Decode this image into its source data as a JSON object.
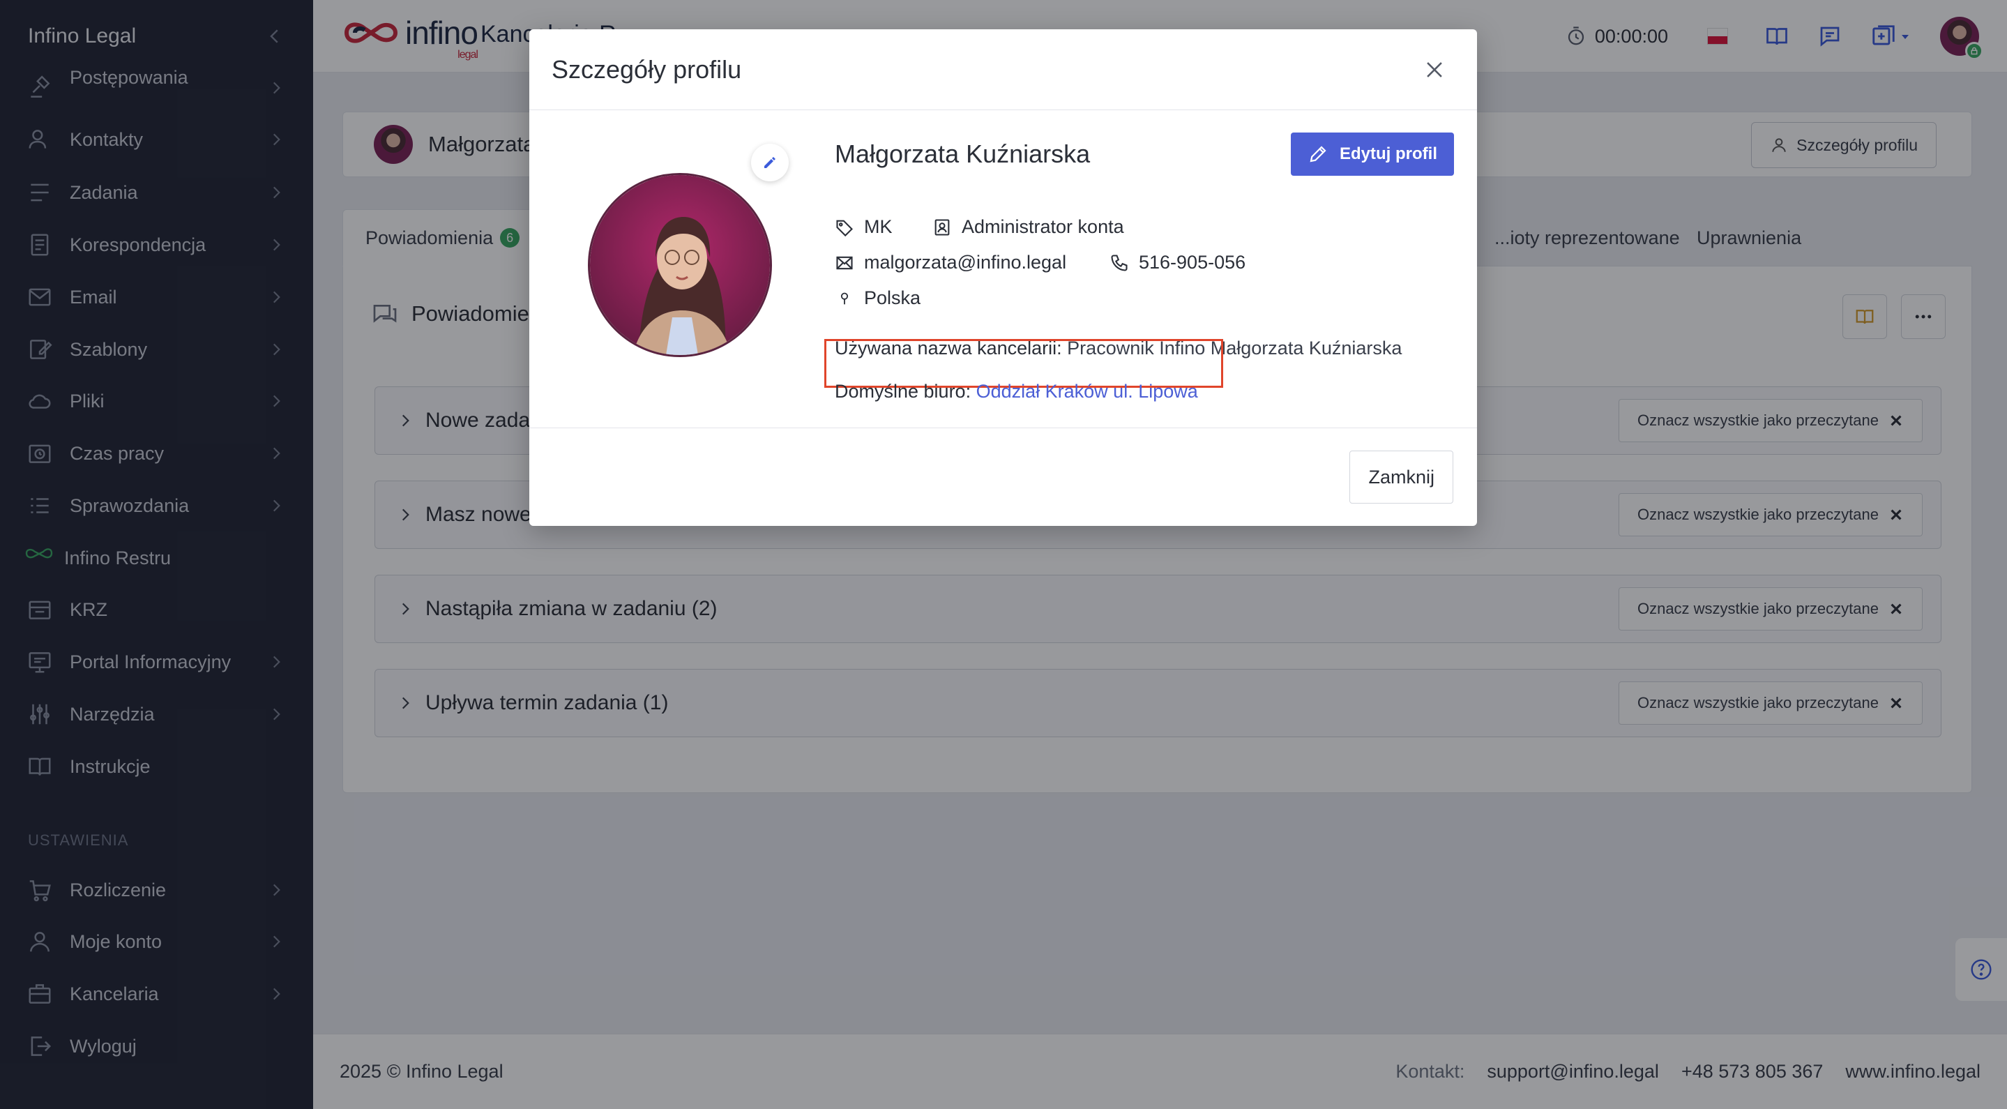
{
  "sidebar": {
    "title": "Infino Legal",
    "items": [
      {
        "label": "Postępowania",
        "icon": "gavel-icon"
      },
      {
        "label": "Kontakty",
        "icon": "contacts-icon"
      },
      {
        "label": "Zadania",
        "icon": "tasks-icon"
      },
      {
        "label": "Korespondencja",
        "icon": "correspondence-icon"
      },
      {
        "label": "Email",
        "icon": "email-icon"
      },
      {
        "label": "Szablony",
        "icon": "templates-icon"
      },
      {
        "label": "Pliki",
        "icon": "cloud-icon"
      },
      {
        "label": "Czas pracy",
        "icon": "clock-icon"
      },
      {
        "label": "Sprawozdania",
        "icon": "reports-icon"
      },
      {
        "label": "Infino Restru",
        "icon": "infino-restru-icon"
      },
      {
        "label": "KRZ",
        "icon": "krz-icon"
      },
      {
        "label": "Portal Informacyjny",
        "icon": "portal-icon"
      },
      {
        "label": "Narzędzia",
        "icon": "tools-icon"
      },
      {
        "label": "Instrukcje",
        "icon": "book-icon"
      }
    ],
    "settings_label": "USTAWIENIA",
    "settings_items": [
      {
        "label": "Rozliczenie",
        "icon": "billing-icon"
      },
      {
        "label": "Moje konto",
        "icon": "user-icon"
      },
      {
        "label": "Kancelaria",
        "icon": "office-icon"
      },
      {
        "label": "Wyloguj",
        "icon": "logout-icon"
      }
    ]
  },
  "topbar": {
    "logo_text": "infino",
    "logo_sub": "legal",
    "org_name": "Kancelaria R...",
    "timer": "00:00:00"
  },
  "header": {
    "name": "Małgorzata",
    "details_button": "Szczegóły profilu"
  },
  "tabs": {
    "notifications_label": "Powiadomienia",
    "notifications_count": "6",
    "represented_label": "...ioty reprezentowane",
    "permissions_label": "Uprawnienia"
  },
  "notifications": {
    "title": "Powiadomienia",
    "groups": [
      {
        "label": "Nowe zadania"
      },
      {
        "label": "Masz nowe ..."
      },
      {
        "label": "Nastąpiła zmiana w zadaniu (2)"
      },
      {
        "label": "Upływa termin zadania (1)"
      }
    ],
    "mark_all_label": "Oznacz wszystkie jako przeczytane"
  },
  "footer": {
    "copyright": "2025 © Infino Legal",
    "contact_label": "Kontakt:",
    "email": "support@infino.legal",
    "phone": "+48 573 805 367",
    "website": "www.infino.legal"
  },
  "modal": {
    "title": "Szczegóły profilu",
    "name": "Małgorzata Kuźniarska",
    "edit_button": "Edytuj profil",
    "initials": "MK",
    "role": "Administrator konta",
    "email": "malgorzata@infino.legal",
    "phone": "516-905-056",
    "country": "Polska",
    "office_name_label": "Używana nazwa kancelarii:",
    "office_name_value": "Pracownik Infino Małgorzata Kuźniarska",
    "default_office_label": "Domyślne biuro:",
    "default_office_value": "Oddział Kraków ul. Lipowa",
    "close_button": "Zamknij"
  },
  "colors": {
    "accent": "#4c5fd5",
    "sidebar_bg": "#232736",
    "highlight": "#e0452b",
    "badge_green": "#3aa862"
  }
}
